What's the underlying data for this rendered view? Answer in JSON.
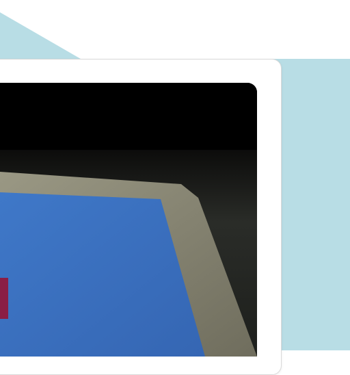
{
  "page": {
    "background_color": "#ffffff",
    "accent_color": "#b8dde5"
  },
  "card": {
    "background_color": "#ffffff",
    "border_color": "#d9d9d9"
  },
  "media": {
    "type": "photo",
    "colors": {
      "top_bar": "#000000",
      "room_dark": "#222522",
      "monitor_bezel": "#8d8b78",
      "screen": "#3c74c4",
      "screen_element": "#8a1e45"
    }
  }
}
